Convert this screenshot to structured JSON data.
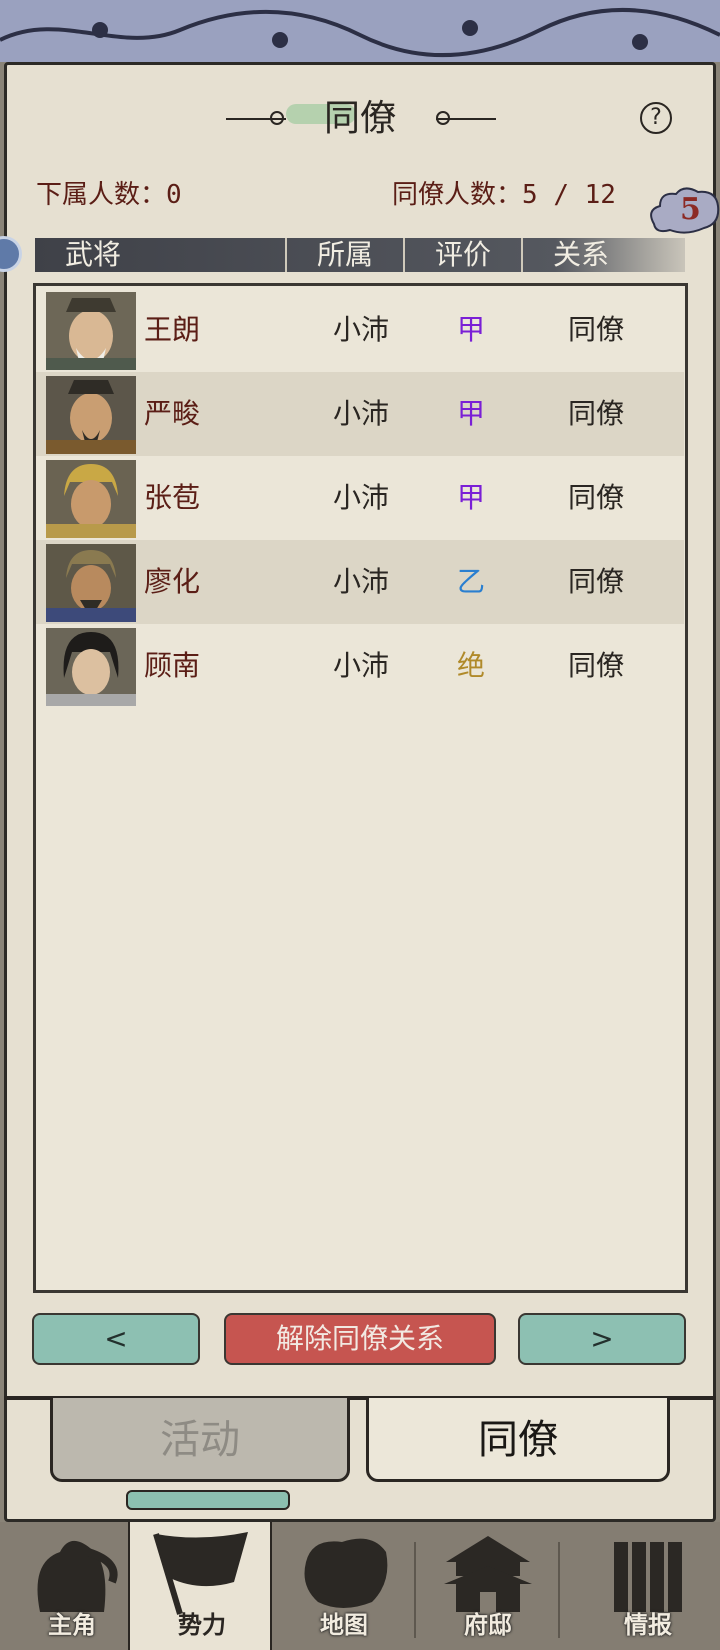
{
  "header": {
    "title": "同僚",
    "help_label": "?",
    "subordinates_label": "下属人数：",
    "subordinates_value": "0",
    "colleagues_label": "同僚人数：",
    "colleagues_value": "5 / 12",
    "badge_count": "5"
  },
  "table": {
    "columns": [
      "武将",
      "所属",
      "评价",
      "关系"
    ],
    "rows": [
      {
        "name": "王朗",
        "affiliation": "小沛",
        "grade": "甲",
        "grade_color": "#7a1fd6",
        "relation": "同僚",
        "portrait": "elder-general"
      },
      {
        "name": "严畯",
        "affiliation": "小沛",
        "grade": "甲",
        "grade_color": "#7a1fd6",
        "relation": "同僚",
        "portrait": "bearded-official"
      },
      {
        "name": "张苞",
        "affiliation": "小沛",
        "grade": "甲",
        "grade_color": "#7a1fd6",
        "relation": "同僚",
        "portrait": "golden-helmet-general"
      },
      {
        "name": "廖化",
        "affiliation": "小沛",
        "grade": "乙",
        "grade_color": "#2a7fd0",
        "relation": "同僚",
        "portrait": "helmeted-warrior"
      },
      {
        "name": "顾南",
        "affiliation": "小沛",
        "grade": "绝",
        "grade_color": "#b08a2a",
        "relation": "同僚",
        "portrait": "young-swordsman"
      }
    ]
  },
  "buttons": {
    "prev": "<",
    "dissolve": "解除同僚关系",
    "next": ">"
  },
  "tabs": {
    "activity": "活动",
    "colleague": "同僚"
  },
  "bottom_nav": {
    "items": [
      {
        "label": "主角",
        "icon": "hero-icon"
      },
      {
        "label": "势力",
        "icon": "faction-flag-icon"
      },
      {
        "label": "地图",
        "icon": "map-icon"
      },
      {
        "label": "府邸",
        "icon": "mansion-icon"
      },
      {
        "label": "情报",
        "icon": "intel-scroll-icon"
      }
    ],
    "active": "势力"
  },
  "colors": {
    "name_text": "#5b1e16",
    "accent_teal": "#8dc0b2",
    "danger_red": "#c65550",
    "panel_bg": "#e6e0d1"
  }
}
